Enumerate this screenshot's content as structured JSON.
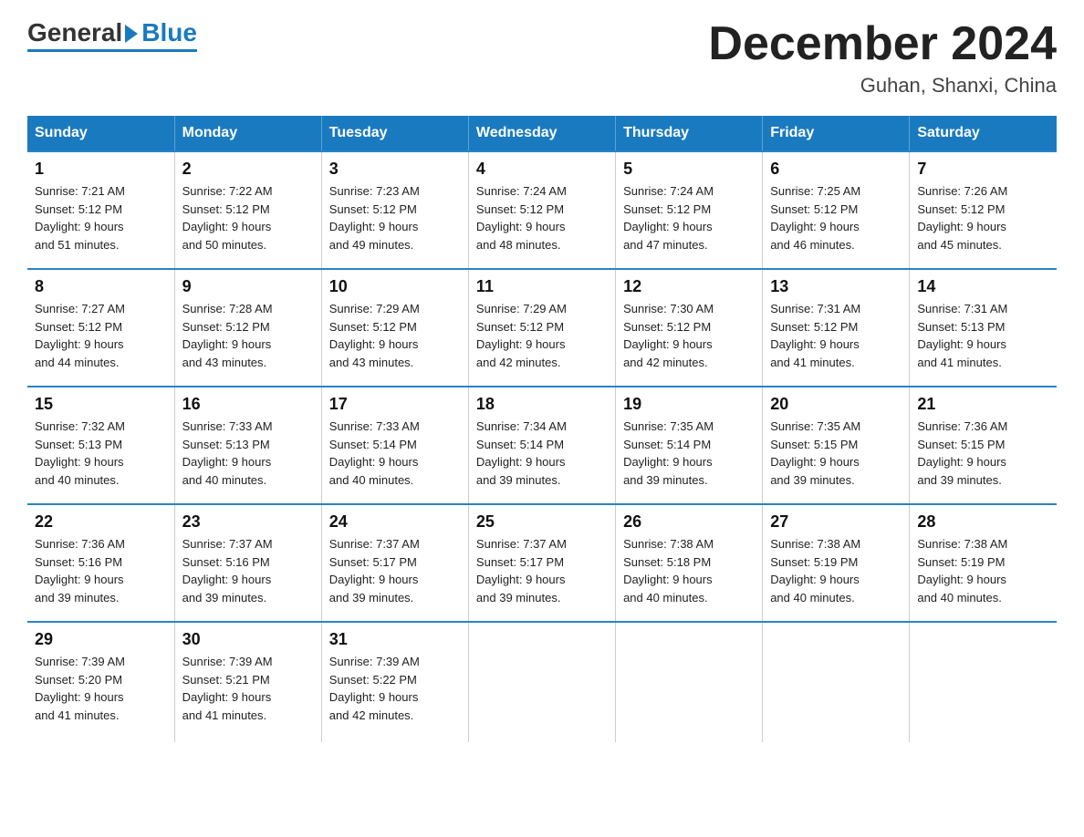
{
  "header": {
    "logo_general": "General",
    "logo_blue": "Blue",
    "month_title": "December 2024",
    "location": "Guhan, Shanxi, China"
  },
  "days_of_week": [
    "Sunday",
    "Monday",
    "Tuesday",
    "Wednesday",
    "Thursday",
    "Friday",
    "Saturday"
  ],
  "weeks": [
    [
      {
        "day": "1",
        "info": "Sunrise: 7:21 AM\nSunset: 5:12 PM\nDaylight: 9 hours\nand 51 minutes."
      },
      {
        "day": "2",
        "info": "Sunrise: 7:22 AM\nSunset: 5:12 PM\nDaylight: 9 hours\nand 50 minutes."
      },
      {
        "day": "3",
        "info": "Sunrise: 7:23 AM\nSunset: 5:12 PM\nDaylight: 9 hours\nand 49 minutes."
      },
      {
        "day": "4",
        "info": "Sunrise: 7:24 AM\nSunset: 5:12 PM\nDaylight: 9 hours\nand 48 minutes."
      },
      {
        "day": "5",
        "info": "Sunrise: 7:24 AM\nSunset: 5:12 PM\nDaylight: 9 hours\nand 47 minutes."
      },
      {
        "day": "6",
        "info": "Sunrise: 7:25 AM\nSunset: 5:12 PM\nDaylight: 9 hours\nand 46 minutes."
      },
      {
        "day": "7",
        "info": "Sunrise: 7:26 AM\nSunset: 5:12 PM\nDaylight: 9 hours\nand 45 minutes."
      }
    ],
    [
      {
        "day": "8",
        "info": "Sunrise: 7:27 AM\nSunset: 5:12 PM\nDaylight: 9 hours\nand 44 minutes."
      },
      {
        "day": "9",
        "info": "Sunrise: 7:28 AM\nSunset: 5:12 PM\nDaylight: 9 hours\nand 43 minutes."
      },
      {
        "day": "10",
        "info": "Sunrise: 7:29 AM\nSunset: 5:12 PM\nDaylight: 9 hours\nand 43 minutes."
      },
      {
        "day": "11",
        "info": "Sunrise: 7:29 AM\nSunset: 5:12 PM\nDaylight: 9 hours\nand 42 minutes."
      },
      {
        "day": "12",
        "info": "Sunrise: 7:30 AM\nSunset: 5:12 PM\nDaylight: 9 hours\nand 42 minutes."
      },
      {
        "day": "13",
        "info": "Sunrise: 7:31 AM\nSunset: 5:12 PM\nDaylight: 9 hours\nand 41 minutes."
      },
      {
        "day": "14",
        "info": "Sunrise: 7:31 AM\nSunset: 5:13 PM\nDaylight: 9 hours\nand 41 minutes."
      }
    ],
    [
      {
        "day": "15",
        "info": "Sunrise: 7:32 AM\nSunset: 5:13 PM\nDaylight: 9 hours\nand 40 minutes."
      },
      {
        "day": "16",
        "info": "Sunrise: 7:33 AM\nSunset: 5:13 PM\nDaylight: 9 hours\nand 40 minutes."
      },
      {
        "day": "17",
        "info": "Sunrise: 7:33 AM\nSunset: 5:14 PM\nDaylight: 9 hours\nand 40 minutes."
      },
      {
        "day": "18",
        "info": "Sunrise: 7:34 AM\nSunset: 5:14 PM\nDaylight: 9 hours\nand 39 minutes."
      },
      {
        "day": "19",
        "info": "Sunrise: 7:35 AM\nSunset: 5:14 PM\nDaylight: 9 hours\nand 39 minutes."
      },
      {
        "day": "20",
        "info": "Sunrise: 7:35 AM\nSunset: 5:15 PM\nDaylight: 9 hours\nand 39 minutes."
      },
      {
        "day": "21",
        "info": "Sunrise: 7:36 AM\nSunset: 5:15 PM\nDaylight: 9 hours\nand 39 minutes."
      }
    ],
    [
      {
        "day": "22",
        "info": "Sunrise: 7:36 AM\nSunset: 5:16 PM\nDaylight: 9 hours\nand 39 minutes."
      },
      {
        "day": "23",
        "info": "Sunrise: 7:37 AM\nSunset: 5:16 PM\nDaylight: 9 hours\nand 39 minutes."
      },
      {
        "day": "24",
        "info": "Sunrise: 7:37 AM\nSunset: 5:17 PM\nDaylight: 9 hours\nand 39 minutes."
      },
      {
        "day": "25",
        "info": "Sunrise: 7:37 AM\nSunset: 5:17 PM\nDaylight: 9 hours\nand 39 minutes."
      },
      {
        "day": "26",
        "info": "Sunrise: 7:38 AM\nSunset: 5:18 PM\nDaylight: 9 hours\nand 40 minutes."
      },
      {
        "day": "27",
        "info": "Sunrise: 7:38 AM\nSunset: 5:19 PM\nDaylight: 9 hours\nand 40 minutes."
      },
      {
        "day": "28",
        "info": "Sunrise: 7:38 AM\nSunset: 5:19 PM\nDaylight: 9 hours\nand 40 minutes."
      }
    ],
    [
      {
        "day": "29",
        "info": "Sunrise: 7:39 AM\nSunset: 5:20 PM\nDaylight: 9 hours\nand 41 minutes."
      },
      {
        "day": "30",
        "info": "Sunrise: 7:39 AM\nSunset: 5:21 PM\nDaylight: 9 hours\nand 41 minutes."
      },
      {
        "day": "31",
        "info": "Sunrise: 7:39 AM\nSunset: 5:22 PM\nDaylight: 9 hours\nand 42 minutes."
      },
      {
        "day": "",
        "info": ""
      },
      {
        "day": "",
        "info": ""
      },
      {
        "day": "",
        "info": ""
      },
      {
        "day": "",
        "info": ""
      }
    ]
  ]
}
